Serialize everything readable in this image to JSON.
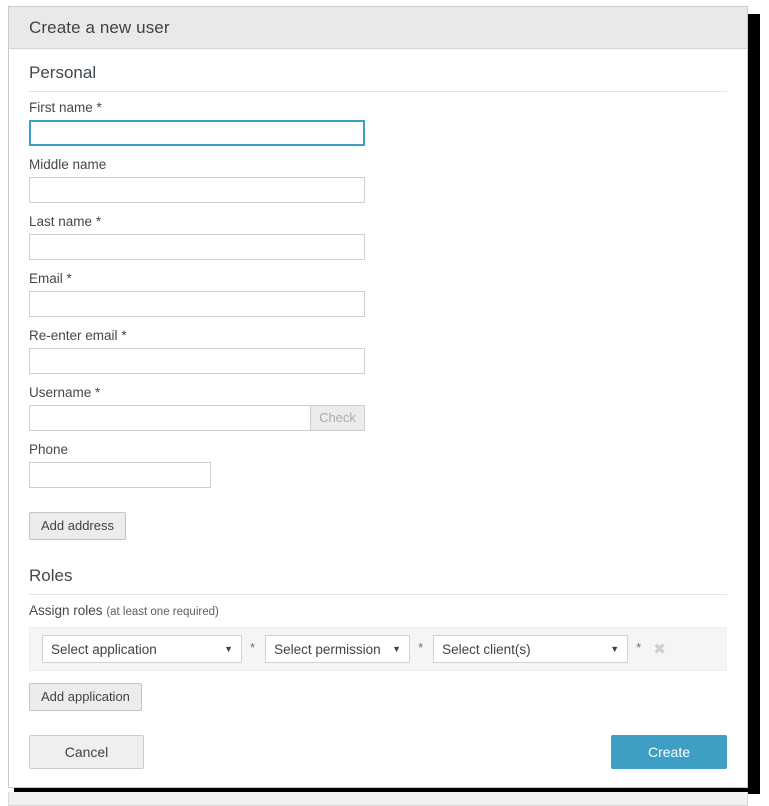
{
  "dialog": {
    "title": "Create a new user"
  },
  "sections": {
    "personal": {
      "heading": "Personal",
      "fields": [
        {
          "label": "First name",
          "required_mark": "*",
          "value": "",
          "placeholder": ""
        },
        {
          "label": "Middle name",
          "required_mark": "",
          "value": "",
          "placeholder": ""
        },
        {
          "label": "Last name",
          "required_mark": "*",
          "value": "",
          "placeholder": ""
        },
        {
          "label": "Email",
          "required_mark": "*",
          "value": "",
          "placeholder": ""
        },
        {
          "label": "Re-enter email",
          "required_mark": "*",
          "value": "",
          "placeholder": ""
        },
        {
          "label": "Username",
          "required_mark": "*",
          "value": "",
          "placeholder": ""
        },
        {
          "label": "Phone",
          "required_mark": "",
          "value": "",
          "placeholder": ""
        }
      ],
      "check_button": "Check",
      "add_address_button": "Add address"
    },
    "roles": {
      "heading": "Roles",
      "assign_label": "Assign roles",
      "assign_hint": "(at least one required)",
      "selects": [
        {
          "value": "Select application",
          "caret_icon": "chevron-down-icon",
          "required_mark": "*"
        },
        {
          "value": "Select permission",
          "caret_icon": "chevron-down-icon",
          "required_mark": "*"
        },
        {
          "value": "Select client(s)",
          "caret_icon": "chevron-down-icon",
          "required_mark": "*"
        }
      ],
      "remove_icon": "close-icon",
      "remove_glyph": "✖",
      "add_application_button": "Add application"
    }
  },
  "footer": {
    "cancel_label": "Cancel",
    "create_label": "Create"
  },
  "colors": {
    "accent": "#3d9fc4",
    "header_bg": "#e9e9e9",
    "panel_bg": "#f5f5f5",
    "border": "#ccd0d2",
    "text": "#42484c"
  }
}
